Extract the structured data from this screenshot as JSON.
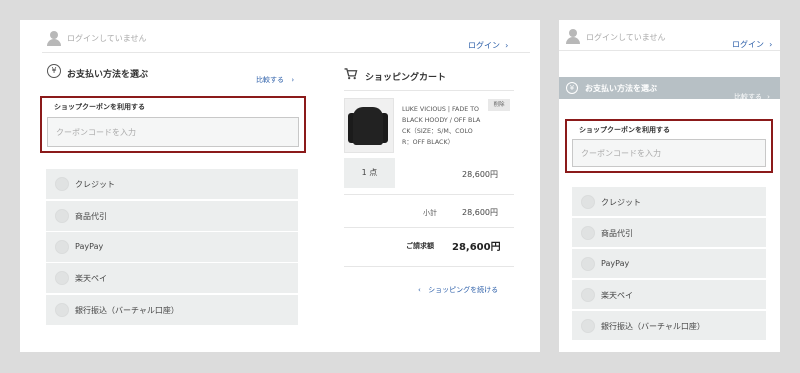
{
  "desktop": {
    "login_status": "ログインしていません",
    "login_link": "ログイン",
    "payment_title": "お支払い方法を選ぶ",
    "payment_compare": "比較する",
    "coupon_label": "ショップクーポンを利用する",
    "coupon_placeholder": "クーポンコードを入力",
    "payment_options": [
      "クレジット",
      "商品代引",
      "PayPay",
      "楽天ペイ",
      "銀行振込（バーチャル口座）"
    ],
    "cart": {
      "title": "ショッピングカート",
      "item_name_lines": [
        "LUKE VICIOUS | FADE TO",
        "BLACK HOODY / OFF BLA",
        "CK（SIZE：S/M、COLO",
        "R：OFF BLACK）"
      ],
      "delete_label": "削除",
      "qty_label": "1 点",
      "item_price": "28,600円",
      "subtotal_label": "小計",
      "subtotal_value": "28,600円",
      "total_label": "ご請求額",
      "total_value": "28,600円",
      "continue_label": "ショッピングを続ける"
    }
  },
  "mobile": {
    "login_status": "ログインしていません",
    "login_link": "ログイン",
    "payment_title": "お支払い方法を選ぶ",
    "payment_compare": "比較する",
    "coupon_label": "ショップクーポンを利用する",
    "coupon_placeholder": "クーポンコードを入力",
    "payment_options": [
      "クレジット",
      "商品代引",
      "PayPay",
      "楽天ペイ",
      "銀行振込（バーチャル口座）"
    ]
  },
  "icons": [
    "user-icon",
    "yen-icon",
    "chevron-right-icon",
    "cart-icon",
    "chevron-left-icon"
  ],
  "colors": {
    "link": "#2a5da8",
    "highlight_border": "#8b1a1a",
    "mobile_header": "#b7c0c5",
    "background": "#dcdcdc"
  }
}
